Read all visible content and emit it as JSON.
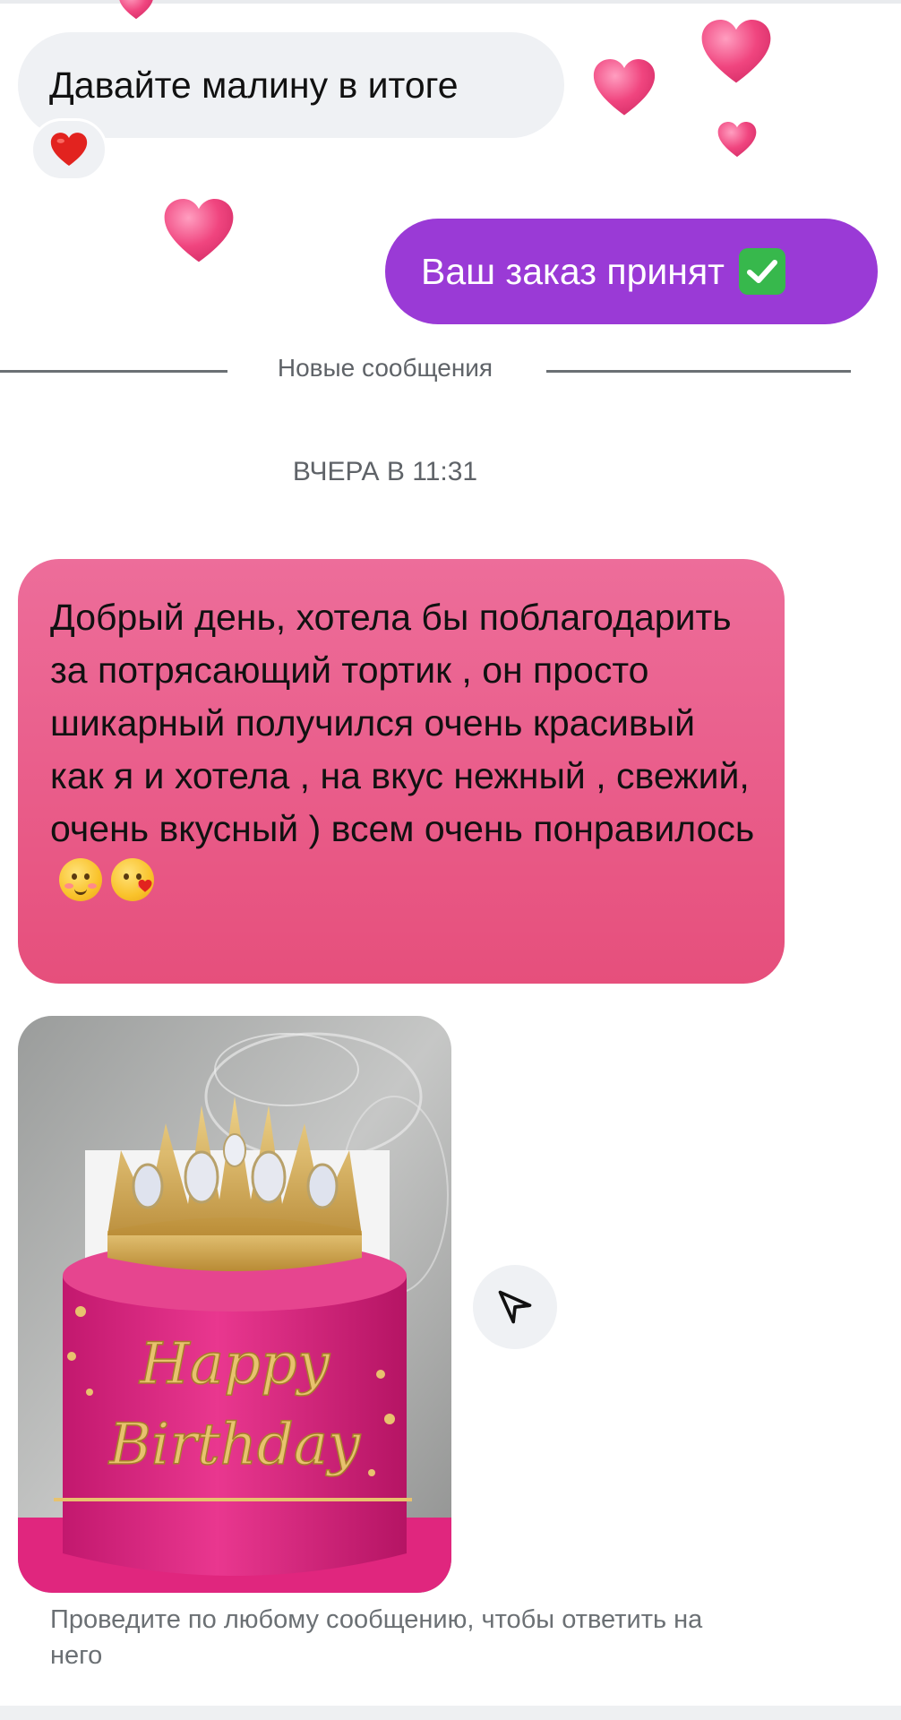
{
  "messages": {
    "incoming_1": {
      "text": "Давайте малину в итоге",
      "reaction": "heart-emoji"
    },
    "outgoing_1": {
      "text": "Ваш заказ принят",
      "emoji": "check-mark-button-emoji"
    },
    "incoming_2": {
      "text": "Добрый день, хотела бы поблагодарить за потрясающий тортик , он просто шикарный получился очень красивый как я и хотела , на вкус нежный , свежий, очень вкусный ) всем очень понравилось",
      "emojis": [
        "smiling-face-with-hearts-emoji",
        "face-blowing-kiss-emoji"
      ]
    },
    "incoming_photo": {
      "description_icon": "cake-photo",
      "topper_text": "Happy Birthday"
    }
  },
  "divider": {
    "label": "Новые сообщения"
  },
  "timestamp": "ВЧЕРА В 11:31",
  "footer": {
    "hint": "Проведите по любому сообщению, чтобы ответить на него"
  },
  "icons": {
    "share": "paper-plane-icon",
    "decor": "floating-heart-icon"
  },
  "colors": {
    "outgoing_bubble": "#9a3ad6",
    "incoming_bubble": "#eff1f4",
    "highlight_bubble_top": "#ed6d9a",
    "highlight_bubble_bottom": "#e64f7c",
    "heart": "#f0457f"
  }
}
